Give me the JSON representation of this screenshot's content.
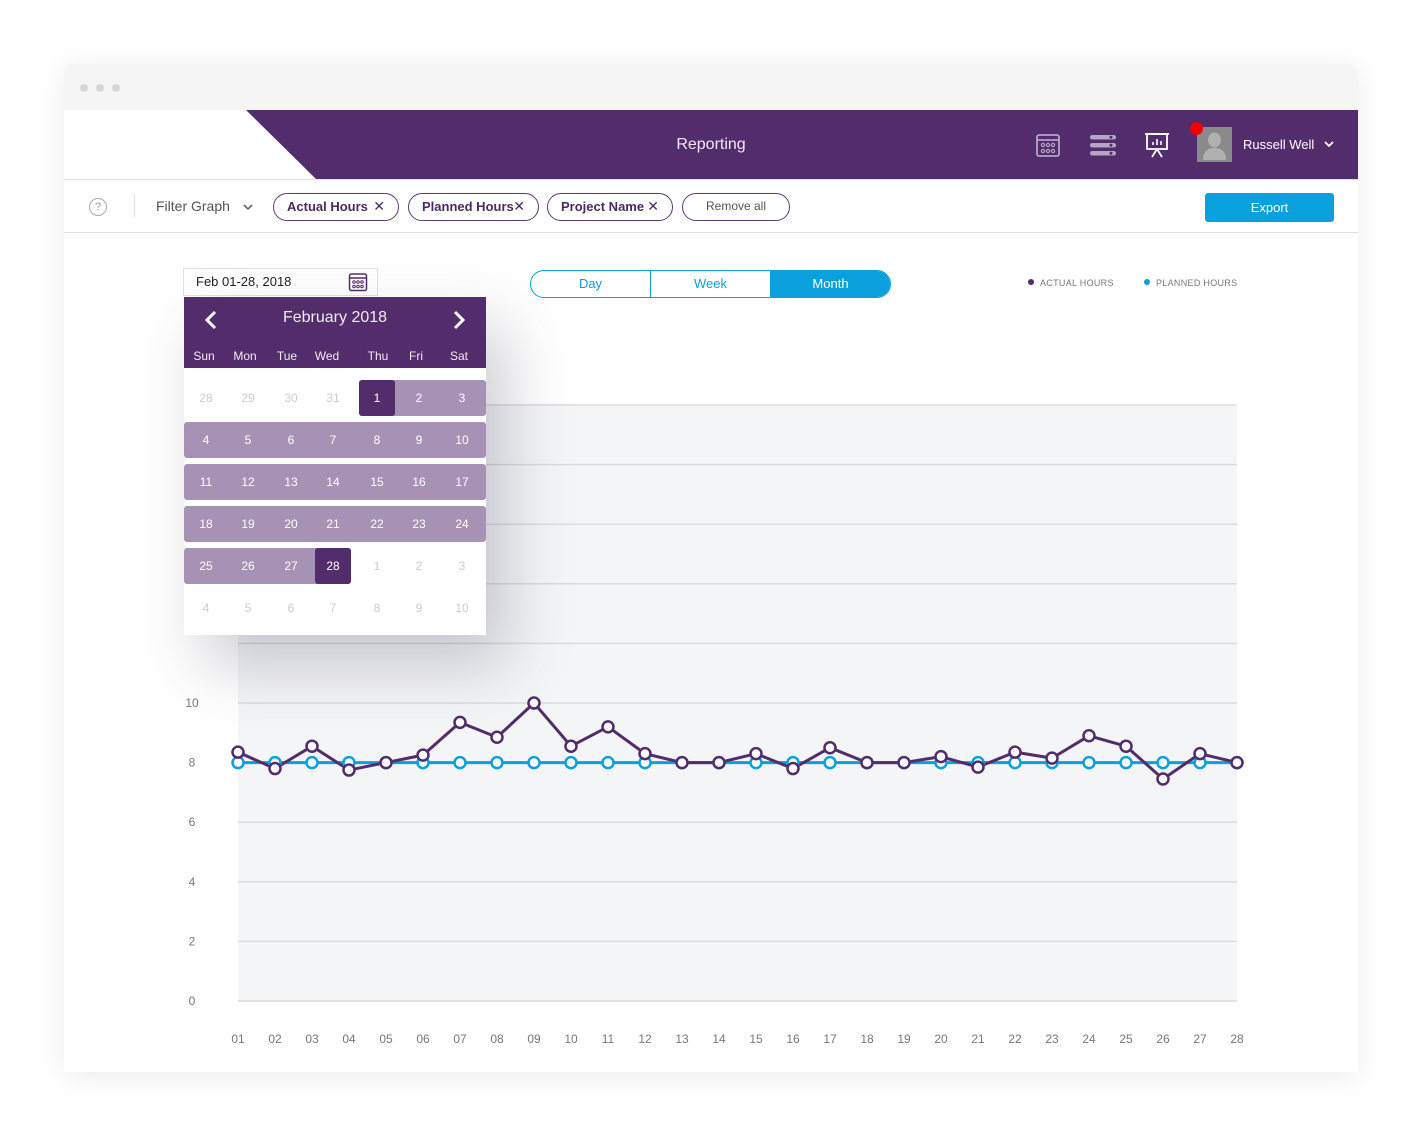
{
  "window": {
    "controls": [
      "close",
      "minimize",
      "maximize"
    ]
  },
  "header": {
    "title": "Reporting",
    "icons": [
      "calendar-grid-icon",
      "list-bars-icon",
      "presentation-chart-icon"
    ],
    "user": {
      "name": "Russell Well",
      "has_notification": true
    }
  },
  "filterbar": {
    "help_icon": "?",
    "filter_label": "Filter Graph",
    "chips": [
      {
        "label": "Actual Hours"
      },
      {
        "label": "Planned Hours"
      },
      {
        "label": "Project Name"
      }
    ],
    "chip_remove_glyph": "✕",
    "remove_all_label": "Remove all",
    "export_label": "Export"
  },
  "date_range": {
    "value": "Feb 01-28, 2018"
  },
  "period_toggle": {
    "options": [
      "Day",
      "Week",
      "Month"
    ],
    "selected": "Month"
  },
  "calendar": {
    "month_label": "February 2018",
    "weekdays": [
      "Sun",
      "Mon",
      "Tue",
      "Wed",
      "Thu",
      "Fri",
      "Sat"
    ],
    "weeks": [
      [
        "28",
        "29",
        "30",
        "31",
        "1",
        "2",
        "3"
      ],
      [
        "4",
        "5",
        "6",
        "7",
        "8",
        "9",
        "10"
      ],
      [
        "11",
        "12",
        "13",
        "14",
        "15",
        "16",
        "17"
      ],
      [
        "18",
        "19",
        "20",
        "21",
        "22",
        "23",
        "24"
      ],
      [
        "25",
        "26",
        "27",
        "28",
        "1",
        "2",
        "3"
      ],
      [
        "4",
        "5",
        "6",
        "7",
        "8",
        "9",
        "10"
      ]
    ],
    "range_start": "1",
    "range_end": "28"
  },
  "colors": {
    "brand_purple": "#532c6c",
    "range_purple": "#a592b5",
    "accent_blue": "#0aa0dc",
    "notification_red": "#f00000"
  },
  "chart_data": {
    "type": "line",
    "title": "",
    "xlabel": "",
    "ylabel": "",
    "x": [
      "01",
      "02",
      "03",
      "04",
      "05",
      "06",
      "07",
      "08",
      "09",
      "10",
      "11",
      "12",
      "13",
      "14",
      "15",
      "16",
      "17",
      "18",
      "19",
      "20",
      "21",
      "22",
      "23",
      "24",
      "25",
      "26",
      "27",
      "28"
    ],
    "ylim": [
      0,
      20
    ],
    "yticks": [
      0,
      2,
      4,
      6,
      8,
      10,
      12,
      14,
      16,
      18,
      20
    ],
    "ytick_labels_visible": [
      "0",
      "2",
      "4",
      "6",
      "8",
      "10"
    ],
    "grid": true,
    "legend": {
      "placement": "top-right",
      "entries": [
        "ACTUAL HOURS",
        "PLANNED HOURS"
      ]
    },
    "series": [
      {
        "name": "ACTUAL HOURS",
        "color": "#532c6c",
        "values": [
          8.35,
          7.8,
          8.55,
          7.75,
          8.0,
          8.25,
          9.35,
          8.85,
          10.0,
          8.55,
          9.2,
          8.3,
          8.0,
          8.0,
          8.3,
          7.8,
          8.5,
          8.0,
          8.0,
          8.2,
          7.85,
          8.35,
          8.15,
          8.9,
          8.55,
          7.45,
          8.3,
          8.0
        ]
      },
      {
        "name": "PLANNED HOURS",
        "color": "#0aa0dc",
        "values": [
          8,
          8,
          8,
          8,
          8,
          8,
          8,
          8,
          8,
          8,
          8,
          8,
          8,
          8,
          8,
          8,
          8,
          8,
          8,
          8,
          8,
          8,
          8,
          8,
          8,
          8,
          8,
          8
        ]
      }
    ]
  }
}
